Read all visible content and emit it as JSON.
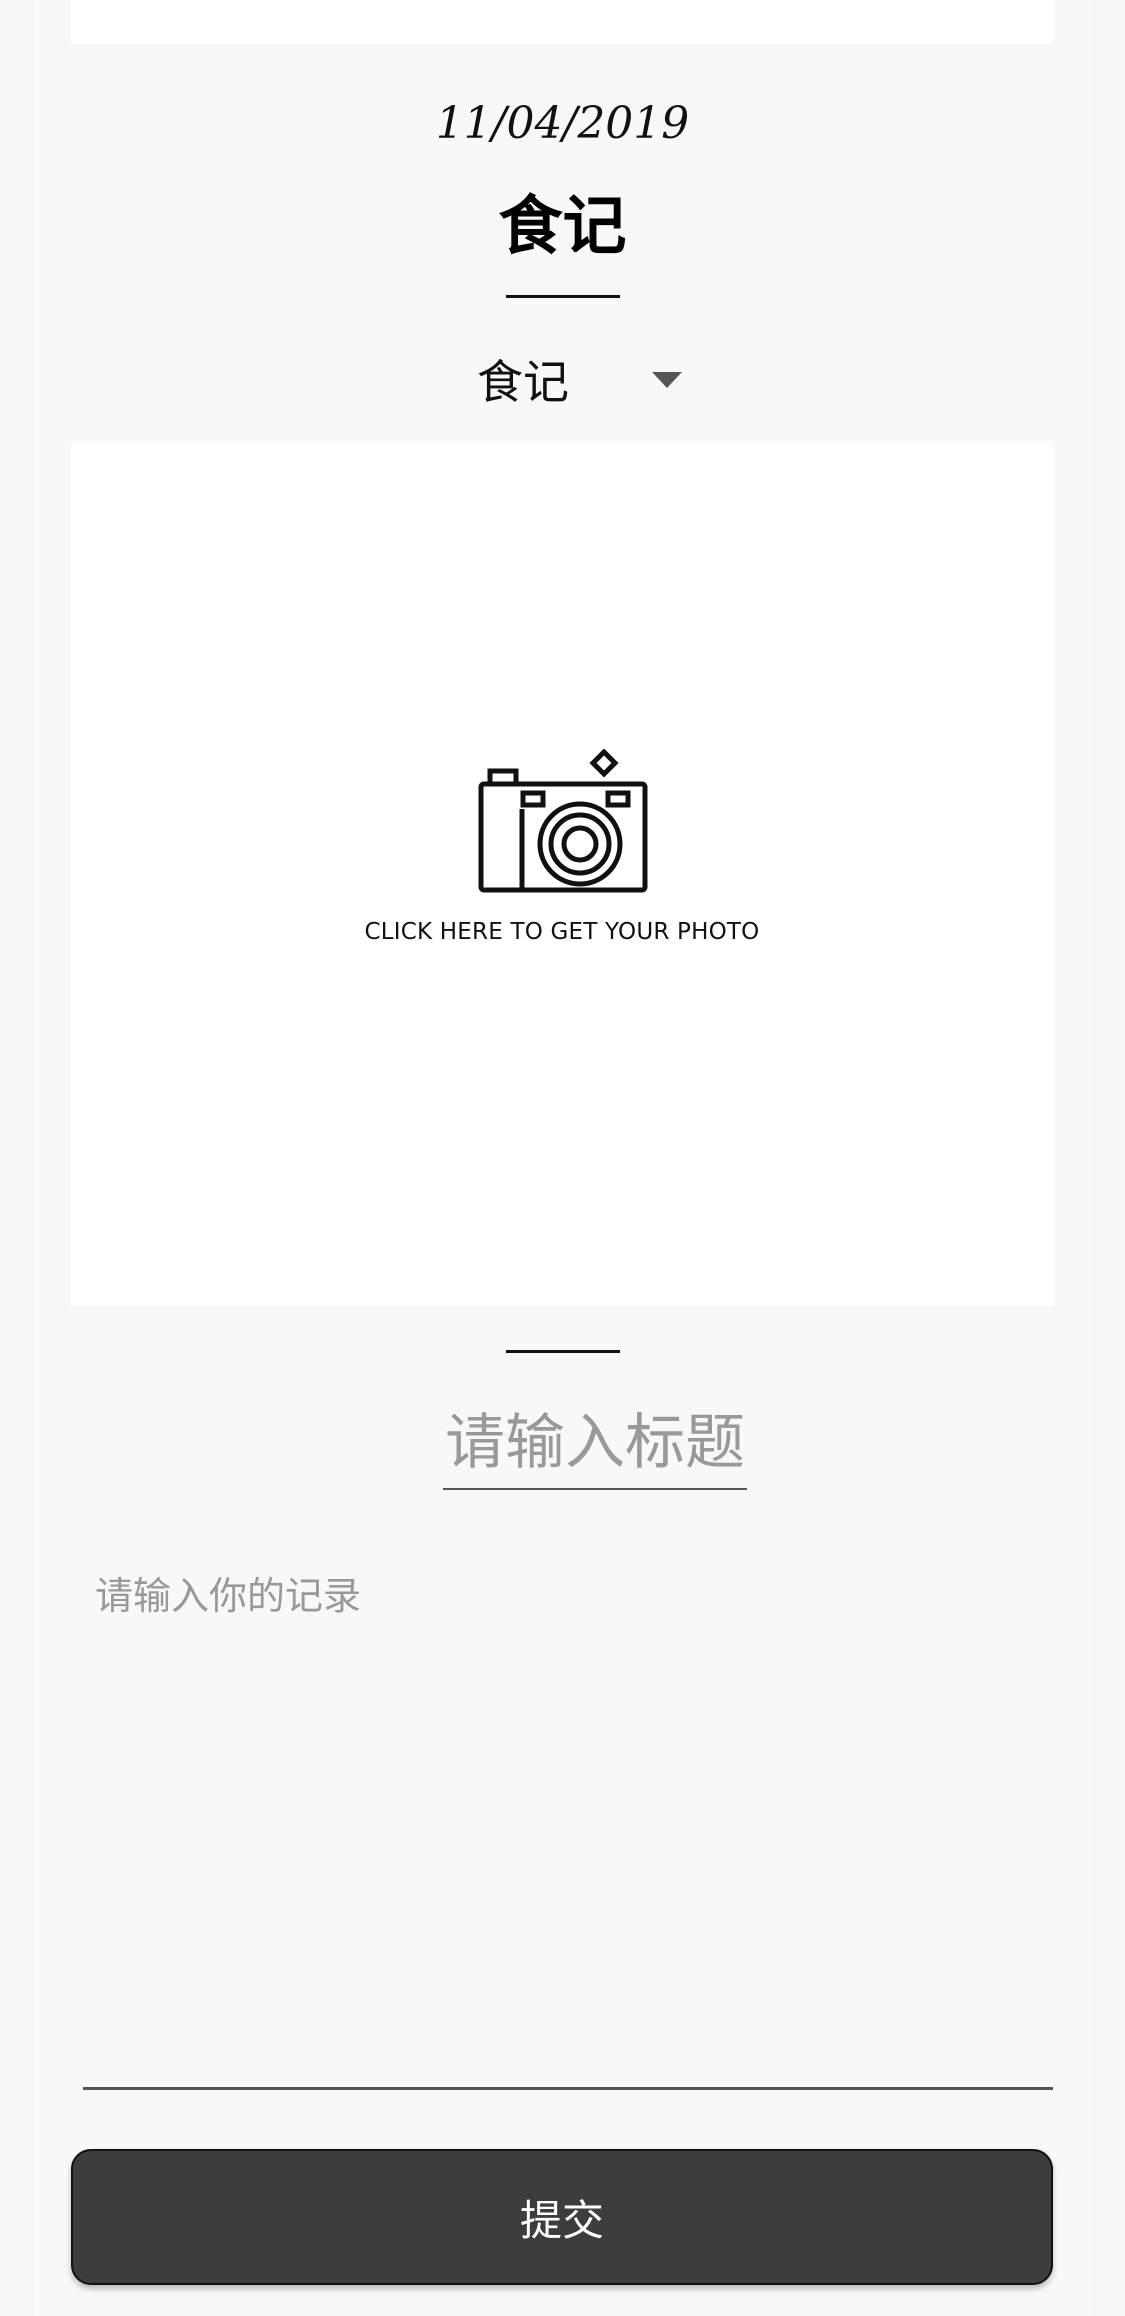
{
  "header": {
    "date": "11/04/2019",
    "title": "食记"
  },
  "category": {
    "selected": "食记"
  },
  "photo": {
    "icon": "camera-icon",
    "hint": "CLICK HERE TO GET YOUR PHOTO"
  },
  "form": {
    "title_placeholder": "请输入标题",
    "record_placeholder": "请输入你的记录",
    "submit_label": "提交"
  }
}
